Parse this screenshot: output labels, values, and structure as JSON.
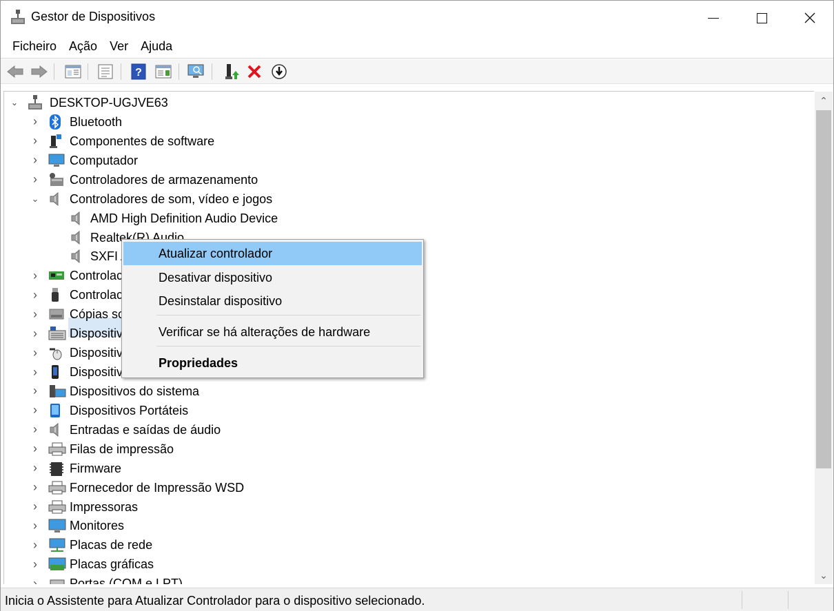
{
  "window": {
    "title": "Gestor de Dispositivos",
    "controls": {
      "minimize": "minimize",
      "maximize": "maximize",
      "close": "close"
    }
  },
  "menubar": {
    "items": [
      "Ficheiro",
      "Ação",
      "Ver",
      "Ajuda"
    ]
  },
  "toolbar": {
    "buttons": [
      "back-arrow-icon",
      "forward-arrow-icon",
      "show-hide-console-tree-icon",
      "properties-icon",
      "help-icon",
      "action-pane-icon",
      "scan-hardware-icon",
      "update-driver-icon",
      "uninstall-device-icon",
      "disable-device-icon"
    ]
  },
  "tree": {
    "root": "DESKTOP-UGJVE63",
    "items": [
      {
        "label": "Bluetooth",
        "icon": "bluetooth-icon",
        "expanded": false
      },
      {
        "label": "Componentes de software",
        "icon": "software-component-icon",
        "expanded": false
      },
      {
        "label": "Computador",
        "icon": "computer-icon",
        "expanded": false
      },
      {
        "label": "Controladores de armazenamento",
        "icon": "storage-controller-icon",
        "expanded": false
      },
      {
        "label": "Controladores de som, vídeo e jogos",
        "icon": "speaker-icon",
        "expanded": true
      },
      {
        "label": "AMD High Definition Audio Device",
        "icon": "speaker-icon",
        "child": true
      },
      {
        "label": "Realtek(R) Audio",
        "icon": "speaker-icon",
        "child": true,
        "selected": true
      },
      {
        "label": "SXFI A",
        "icon": "speaker-icon",
        "child": true
      },
      {
        "label": "Controlac",
        "icon": "ide-controller-icon",
        "expanded": false
      },
      {
        "label": "Controlac",
        "icon": "usb-icon",
        "expanded": false
      },
      {
        "label": "Cópias sc",
        "icon": "disk-icon",
        "expanded": false
      },
      {
        "label": "Dispositiv",
        "icon": "keyboard-icon",
        "expanded": false
      },
      {
        "label": "Dispositiv",
        "icon": "mouse-icon",
        "expanded": false
      },
      {
        "label": "Dispositiv",
        "icon": "phone-icon",
        "expanded": false
      },
      {
        "label": "Dispositivos do sistema",
        "icon": "system-device-icon",
        "expanded": false
      },
      {
        "label": "Dispositivos Portáteis",
        "icon": "portable-device-icon",
        "expanded": false
      },
      {
        "label": "Entradas e saídas de áudio",
        "icon": "speaker-icon",
        "expanded": false
      },
      {
        "label": "Filas de impressão",
        "icon": "printer-icon",
        "expanded": false
      },
      {
        "label": "Firmware",
        "icon": "firmware-icon",
        "expanded": false
      },
      {
        "label": "Fornecedor de Impressão WSD",
        "icon": "printer-icon",
        "expanded": false
      },
      {
        "label": "Impressoras",
        "icon": "printer-icon",
        "expanded": false
      },
      {
        "label": "Monitores",
        "icon": "monitor-icon",
        "expanded": false
      },
      {
        "label": "Placas de rede",
        "icon": "network-adapter-icon",
        "expanded": false
      },
      {
        "label": "Placas gráficas",
        "icon": "display-adapter-icon",
        "expanded": false
      },
      {
        "label": "Portas (COM e LPT)",
        "icon": "port-icon",
        "expanded": false
      }
    ]
  },
  "context_menu": {
    "items": [
      {
        "label": "Atualizar controlador",
        "highlighted": true
      },
      {
        "label": "Desativar dispositivo"
      },
      {
        "label": "Desinstalar dispositivo"
      },
      {
        "label": "Verificar se há alterações de hardware"
      },
      {
        "label": "Propriedades",
        "bold": true
      }
    ]
  },
  "statusbar": {
    "text": "Inicia o Assistente para Atualizar Controlador para o dispositivo selecionado."
  },
  "colors": {
    "highlight": "#91c9f7",
    "selection": "#d9e8f7",
    "uninstall_red": "#e0141e"
  }
}
